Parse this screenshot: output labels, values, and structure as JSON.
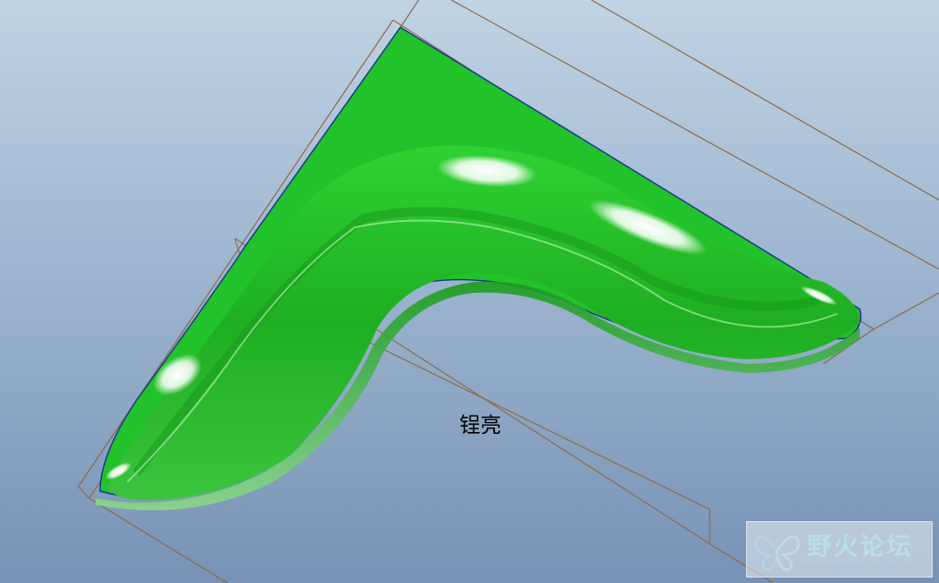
{
  "model": {
    "label": "锃亮",
    "color": "#22c22a",
    "edge_color": "#1a3a8a",
    "datum_frame_color": "#8c6a4a"
  },
  "background": {
    "top_color": "#c1d3e4",
    "bottom_color": "#7792b4"
  },
  "watermark": {
    "title": "野火论坛",
    "url": "www.proewildfire.cn",
    "logo": "butterfly-logo-icon"
  }
}
